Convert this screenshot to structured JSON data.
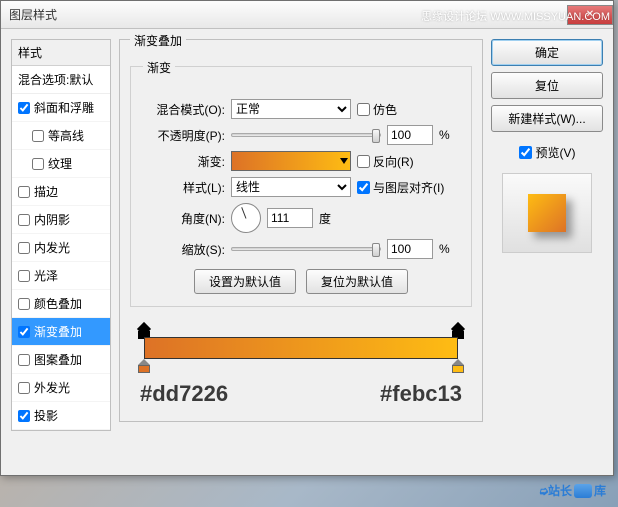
{
  "watermark": {
    "top": "思缘设计论坛  WWW.MISSYUAN.COM",
    "bottom_pre": "站长",
    "bottom_post": "库"
  },
  "dialog": {
    "title": "图层样式",
    "left": {
      "styles_header": "样式",
      "blend_options": "混合选项:默认",
      "items": [
        {
          "label": "斜面和浮雕",
          "checked": true,
          "indented": false
        },
        {
          "label": "等高线",
          "checked": false,
          "indented": true
        },
        {
          "label": "纹理",
          "checked": false,
          "indented": true
        },
        {
          "label": "描边",
          "checked": false,
          "indented": false
        },
        {
          "label": "内阴影",
          "checked": false,
          "indented": false
        },
        {
          "label": "内发光",
          "checked": false,
          "indented": false
        },
        {
          "label": "光泽",
          "checked": false,
          "indented": false
        },
        {
          "label": "颜色叠加",
          "checked": false,
          "indented": false
        },
        {
          "label": "渐变叠加",
          "checked": true,
          "indented": false,
          "selected": true
        },
        {
          "label": "图案叠加",
          "checked": false,
          "indented": false
        },
        {
          "label": "外发光",
          "checked": false,
          "indented": false
        },
        {
          "label": "投影",
          "checked": true,
          "indented": false
        }
      ]
    },
    "mid": {
      "panel_title": "渐变叠加",
      "section_title": "渐变",
      "blend_mode_label": "混合模式(O):",
      "blend_mode_value": "正常",
      "dither_label": "仿色",
      "opacity_label": "不透明度(P):",
      "opacity_value": "100",
      "percent": "%",
      "gradient_label": "渐变:",
      "reverse_label": "反向(R)",
      "style_label": "样式(L):",
      "style_value": "线性",
      "align_label": "与图层对齐(I)",
      "angle_label": "角度(N):",
      "angle_value": "111",
      "degree": "度",
      "scale_label": "缩放(S):",
      "scale_value": "100",
      "set_default": "设置为默认值",
      "reset_default": "复位为默认值",
      "color_left": "#dd7226",
      "color_right": "#febc13"
    },
    "right": {
      "ok": "确定",
      "cancel": "复位",
      "new_style": "新建样式(W)...",
      "preview": "预览(V)"
    }
  }
}
